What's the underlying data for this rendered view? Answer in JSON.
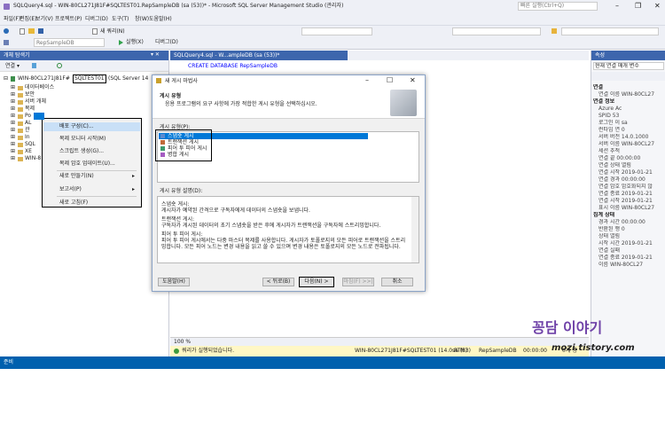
{
  "app": {
    "title": "SQLQuery4.sql - WIN-80CL271J81F#SQLTEST01.RepSampleDB (sa (53))* - Microsoft SQL Server Management Studio (관리자)",
    "quick_launch": "빠른 실행(Ctrl+Q)"
  },
  "menu": [
    "파일(F)",
    "편집(E)",
    "보기(V)",
    "프로젝트(P)",
    "디버그(D)",
    "도구(T)",
    "창(W)",
    "도움말(H)"
  ],
  "toolbar": {
    "new_query": "새 쿼리(N)",
    "db_selector": "RepSampleDB",
    "execute": "실행(X)",
    "debug": "디버그(D)"
  },
  "object_explorer": {
    "title": "개체 탐색기",
    "connect": "연결 ▾",
    "server_prefix": "WIN-80CL271J81F#",
    "server_name": "SQLTEST01",
    "server_suffix": "(SQL Server 14",
    "items": [
      "데이터베이스",
      "보안",
      "서버 개체",
      "복제",
      "Po",
      "AL",
      "관",
      "In",
      "SQL",
      "XE",
      "WIN-8"
    ]
  },
  "context_menu": {
    "items": [
      "배포 구성(C)...",
      "복제 모니터 시작(M)",
      "스크립트 생성(G)...",
      "복제 암호 업데이트(U)...",
      "새로 만들기(N)",
      "보고서(P)",
      "새로 고침(F)"
    ]
  },
  "editor": {
    "tab_title": "SQLQuery4.sql - W...ampleDB (sa (53))*",
    "code": "CREATE DATABASE RepSampleDB",
    "zoom": "100 %",
    "status_text": "쿼리가 실행되었습니다.",
    "status_server": "WIN-80CL271J81F#SQLTEST01 (14.0 RTM)",
    "status_user": "sa (53)",
    "status_db": "RepSampleDB",
    "status_time": "00:00:00",
    "status_rows": "0개 행"
  },
  "wizard": {
    "title": "새 게시 마법사",
    "header_title": "게시 유형",
    "header_subtitle": "응용 프로그램의 요구 사항에 가장 적합한 게시 유형을 선택하십시오.",
    "list_label": "게시 유형(P):",
    "types": [
      "스냅숏 게시",
      "트랜잭션 게시",
      "피어 투 피어 게시",
      "병합 게시"
    ],
    "desc_label": "게시 유형 설명(D):",
    "description": [
      "스냅숏 게시:",
      "게시자가 예약된 간격으로 구독자에게 데이터의 스냅숏을 보냅니다.",
      "트랜잭션 게시:",
      "구독자가 게시된 데이터의 초기 스냅숏을 받은 후에 게시자가 트랜잭션을 구독자에 스트리밍합니다.",
      "피어 투 피어 게시:",
      "피어 투 피어 게시에서는 다중 마스터 복제를 사용합니다. 게시자가 토폴로지의 모든 피어로 트랜잭션을 스트리밍합니다. 모든 피어 노드는 변경 내용을 읽고 쓸 수 있으며 변경 내용은 토폴로지의 모든 노드로 전파됩니다."
    ],
    "buttons": {
      "help": "도움말(H)",
      "back": "< 뒤로(B)",
      "next": "다음(N) >",
      "finish": "마침(F) >>|",
      "cancel": "취소"
    }
  },
  "properties": {
    "title": "속성",
    "selector": "현재 연결 매개 변수",
    "sections": [
      "연결",
      "연결 정보",
      "집계 상태"
    ],
    "rows": [
      "연결 이름 WIN-80CL27",
      "Azure Ac",
      "SPID 53",
      "로그인 이 sa",
      "런타임 연 0",
      "서버 버전 14.0.1000",
      "서버 이름 WIN-80CL27",
      "세션 추적",
      "연결 끝 00:00:00",
      "연결 상태 열림",
      "연결 시작 2019-01-21",
      "연결 경과 00:00:00",
      "연결 암호 암호화되지 않",
      "연결 종료 2019-01-21",
      "연결 시작 2019-01-21",
      "표시 이름 WIN-80CL27",
      "경과 시간 00:00:00",
      "반환된 행 0",
      "상태 열림",
      "시작 시간 2019-01-21",
      "연결 실패",
      "연결 종료 2019-01-21",
      "이름 WIN-80CL27"
    ]
  },
  "status": {
    "ready": "준비"
  },
  "watermark": {
    "line1": "꽁담 이야기",
    "line2": "mozi.tistory.com"
  },
  "colors": {
    "accent": "#0078d7",
    "status": "#0060ae",
    "panel": "#3d66ad"
  }
}
